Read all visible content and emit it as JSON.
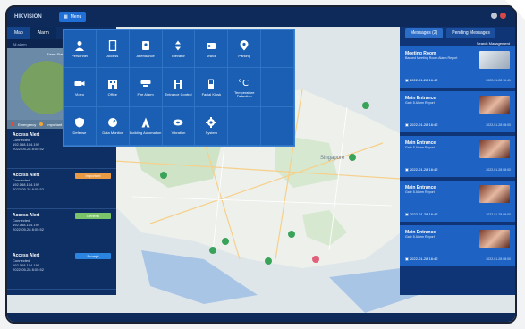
{
  "app": {
    "brand": "HIKVISION",
    "menu_label": "Menu"
  },
  "left": {
    "tabs": [
      "Map",
      "Alarm"
    ],
    "sub": "All alarm",
    "chart_title": "Alarm Status",
    "legend": [
      {
        "label": "Emergency",
        "color": "#e04b3a"
      },
      {
        "label": "Important",
        "color": "#f2a53a"
      }
    ],
    "alerts": [
      {
        "title": "Access Alert",
        "status": "Emergency",
        "color": "#e0422e",
        "l1": "Connected",
        "l2": "192.168.104.192",
        "l3": "2022-05-28 8:05:52"
      },
      {
        "title": "Access Alert",
        "status": "Important",
        "color": "#e99a45",
        "l1": "Connected",
        "l2": "192.168.104.192",
        "l3": "2022-05-28 8:05:52"
      },
      {
        "title": "Access Alert",
        "status": "General",
        "color": "#7cc46a",
        "l1": "Connected",
        "l2": "192.168.104.192",
        "l3": "2022-05-28 8:05:52"
      },
      {
        "title": "Access Alert",
        "status": "Prompt",
        "color": "#2a84e0",
        "l1": "Connected",
        "l2": "192.168.104.192",
        "l3": "2022-05-28 8:05:52"
      }
    ]
  },
  "menu": {
    "items": [
      {
        "label": "Personnel",
        "icon": "person-icon"
      },
      {
        "label": "Access",
        "icon": "door-icon"
      },
      {
        "label": "Attendance",
        "icon": "badge-icon"
      },
      {
        "label": "Elevator",
        "icon": "elevator-icon"
      },
      {
        "label": "Visitor",
        "icon": "visitor-icon"
      },
      {
        "label": "Parking",
        "icon": "parking-pin-icon"
      },
      {
        "label": "",
        "icon": ""
      },
      {
        "label": "Video",
        "icon": "camera-icon"
      },
      {
        "label": "Office",
        "icon": "office-icon"
      },
      {
        "label": "Fire Alarm",
        "icon": "fire-alarm-icon"
      },
      {
        "label": "Entrance Control",
        "icon": "turnstile-icon"
      },
      {
        "label": "Facial Kiosk",
        "icon": "kiosk-icon"
      },
      {
        "label": "Temperature Detection",
        "icon": "thermometer-icon"
      },
      {
        "label": "",
        "icon": ""
      },
      {
        "label": "Defense",
        "icon": "shield-icon"
      },
      {
        "label": "Data Monitor",
        "icon": "gauge-icon"
      },
      {
        "label": "Building Automation",
        "icon": "building-icon"
      },
      {
        "label": "Vibration",
        "icon": "vibration-icon"
      },
      {
        "label": "System",
        "icon": "gear-icon"
      },
      {
        "label": "",
        "icon": ""
      },
      {
        "label": "",
        "icon": ""
      }
    ]
  },
  "map": {
    "city_label": "Singapore"
  },
  "right": {
    "tabs": [
      "Messages (2)",
      "Pending Messages"
    ],
    "sub": "Search Management",
    "messages": [
      {
        "title": "Meeting Room",
        "sub": "Backed Meeting Room Alarm Report",
        "time": "2022-01-28 16:42",
        "ts": "2022-01-28 16:41"
      },
      {
        "title": "Main Entrance",
        "sub": "Gate 5 Alarm Report",
        "time": "2022-01-28 16:42",
        "ts": "2022-01-28 08:00"
      },
      {
        "title": "Main Entrance",
        "sub": "Gate 5 Alarm Report",
        "time": "2022-01-28 16:42",
        "ts": "2022-01-28 08:00"
      },
      {
        "title": "Main Entrance",
        "sub": "Gate 5 Alarm Report",
        "time": "2022-01-28 16:42",
        "ts": "2022-01-28 08:00"
      },
      {
        "title": "Main Entrance",
        "sub": "Gate 5 Alarm Report",
        "time": "2022-01-28 16:42",
        "ts": "2022-01-28 08:00"
      }
    ]
  }
}
